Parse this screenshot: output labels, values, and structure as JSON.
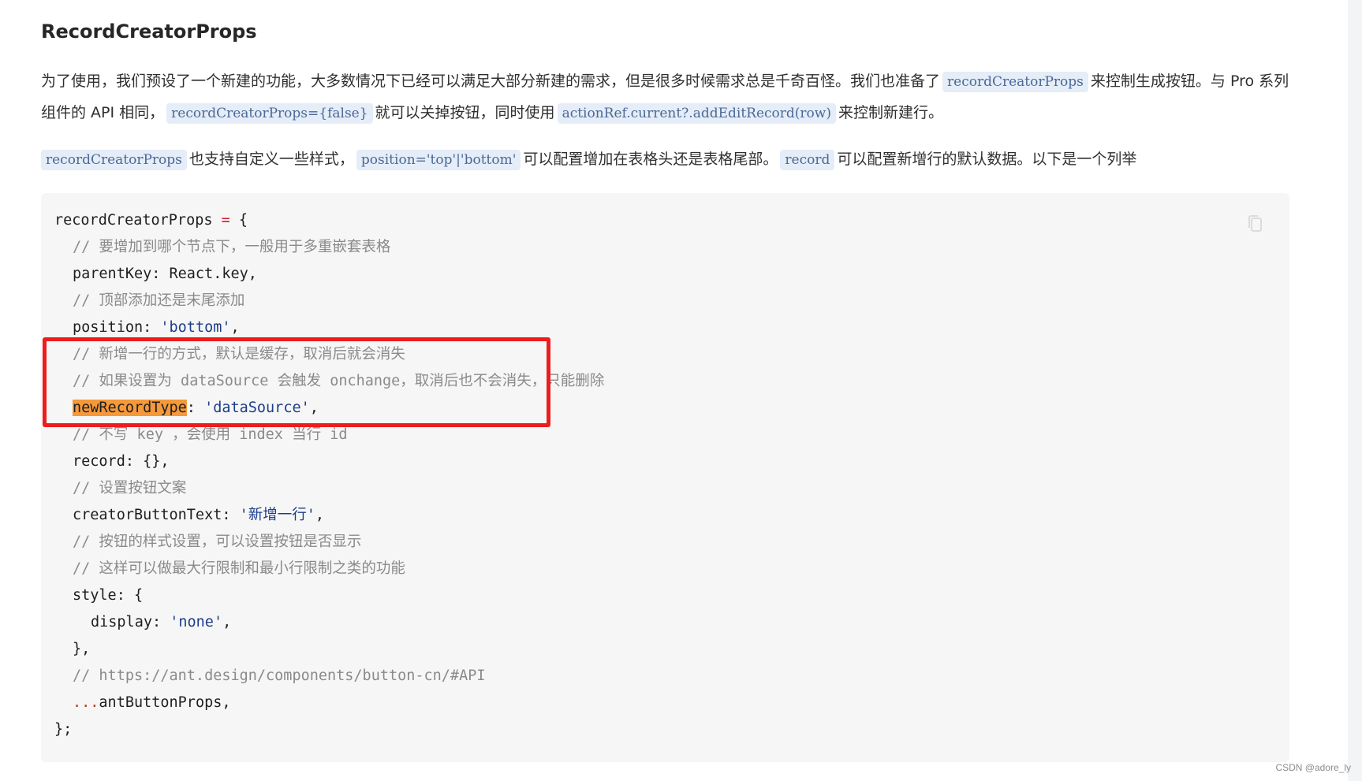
{
  "title": "RecordCreatorProps",
  "paragraph1": {
    "text1": "为了使用，我们预设了一个新建的功能，大多数情况下已经可以满足大部分新建的需求，但是很多时候需求总是千奇百怪。我们也准备了",
    "code1": "recordCreatorProps",
    "text2": "来控制生成按钮。与 Pro 系列组件的 API 相同，",
    "code2": "recordCreatorProps={false}",
    "text3": "就可以关掉按钮，同时使用",
    "code3": "actionRef.current?.addEditRecord(row)",
    "text4": "来控制新建行。"
  },
  "paragraph2": {
    "code1": "recordCreatorProps",
    "text1": "也支持自定义一些样式，",
    "code2": "position='top'|'bottom'",
    "text2": "可以配置增加在表格头还是表格尾部。",
    "code3": "record",
    "text3": "可以配置新增行的默认数据。以下是一个列举"
  },
  "code": {
    "l1_a": "recordCreatorProps ",
    "l1_op": "=",
    "l1_b": " {",
    "l2": "// 要增加到哪个节点下，一般用于多重嵌套表格",
    "l3": "parentKey: React.key,",
    "l4": "// 顶部添加还是末尾添加",
    "l5_key": "position: ",
    "l5_val": "'bottom'",
    "l5_end": ",",
    "l6": "// 新增一行的方式，默认是缓存，取消后就会消失",
    "l7": "// 如果设置为 dataSource 会触发 onchange，取消后也不会消失，只能删除",
    "l8_key": "newRecordType",
    "l8_sep": ": ",
    "l8_val": "'dataSource'",
    "l8_end": ",",
    "l9": "// 不写 key ，会使用 index 当行 id",
    "l10": "record: {},",
    "l11": "// 设置按钮文案",
    "l12_key": "creatorButtonText: ",
    "l12_val": "'新增一行'",
    "l12_end": ",",
    "l13": "// 按钮的样式设置，可以设置按钮是否显示",
    "l14": "// 这样可以做最大行限制和最小行限制之类的功能",
    "l15": "style: {",
    "l16_key": "display: ",
    "l16_val": "'none'",
    "l16_end": ",",
    "l17": "},",
    "l18": "// https://ant.design/components/button-cn/#API",
    "l19_spread": "...",
    "l19_rest": "antButtonProps,",
    "l20": "};"
  },
  "watermark": "CSDN @adore_ly",
  "colors": {
    "highlight": "#f5993a",
    "annotation_box": "#ee1c1c",
    "inline_code_bg": "#e4edf8"
  },
  "icons": {
    "copy": "copy-icon"
  }
}
